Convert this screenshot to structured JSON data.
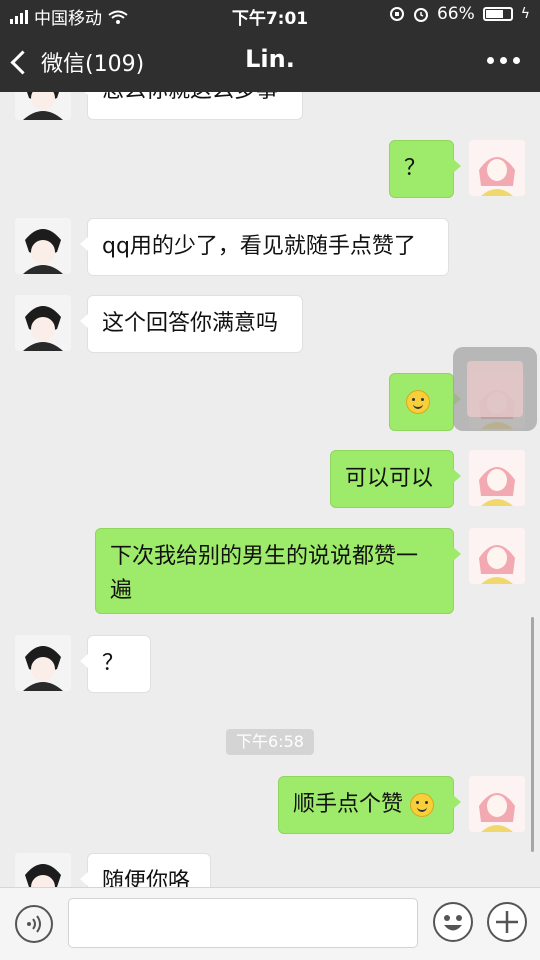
{
  "status_bar": {
    "carrier": "中国移动",
    "time": "下午7:01",
    "battery_pct": "66%"
  },
  "nav": {
    "back_label": "微信(109)",
    "title": "Lin.",
    "more_icon": "more-dots-icon"
  },
  "messages": [
    {
      "side": "in",
      "text": "怎么你就这么多事"
    },
    {
      "side": "out",
      "text": "？"
    },
    {
      "side": "in",
      "text": "qq用的少了，看见就随手点赞了"
    },
    {
      "side": "in",
      "text": "这个回答你满意吗"
    },
    {
      "side": "out",
      "text": "",
      "emoji": "smiley"
    },
    {
      "side": "out",
      "text": "可以可以"
    },
    {
      "side": "out",
      "text": "下次我给别的男生的说说都赞一遍"
    },
    {
      "side": "in",
      "text": "？"
    },
    {
      "side": "out",
      "text": "顺手点个赞",
      "emoji": "smiley"
    },
    {
      "side": "in",
      "text": "随便你咯"
    }
  ],
  "timestamp": "下午6:58",
  "input": {
    "value": "",
    "voice_icon": "voice-icon",
    "emoji_icon": "emoji-icon",
    "plus_icon": "plus-icon"
  },
  "colors": {
    "nav_bg": "#2f2f2f",
    "chat_bg": "#ededed",
    "out_bubble": "#9eea6a",
    "in_bubble": "#ffffff"
  }
}
